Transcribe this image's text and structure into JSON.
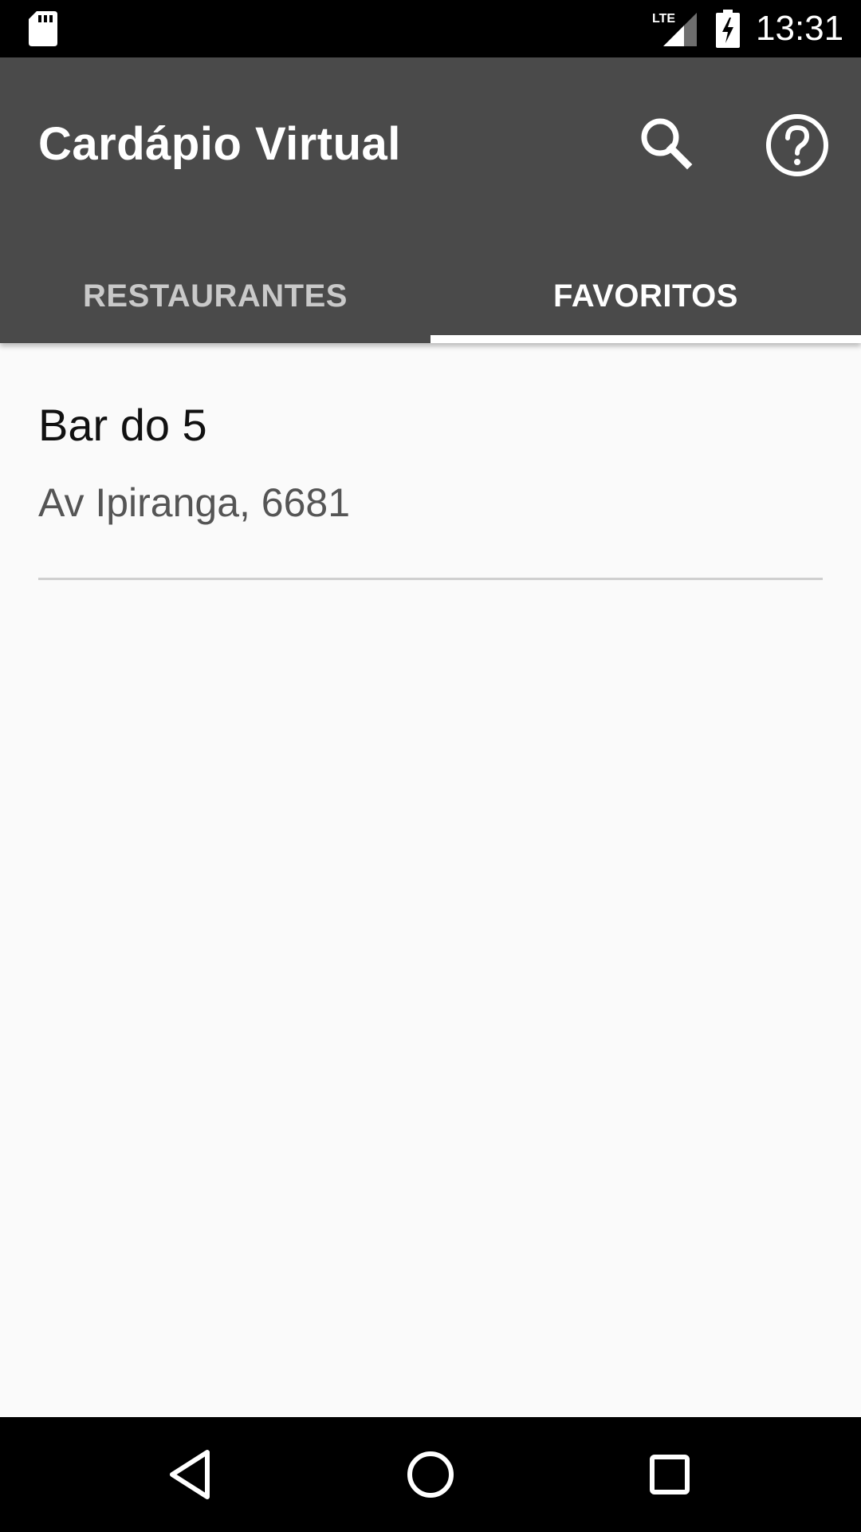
{
  "status_bar": {
    "time": "13:31",
    "network": "LTE",
    "icons": [
      "sd-card-icon",
      "lte-signal-icon",
      "battery-charging-icon"
    ]
  },
  "app_bar": {
    "title": "Cardápio Virtual",
    "actions": [
      "search-icon",
      "help-icon"
    ],
    "background_color": "#4a4a4a"
  },
  "tabs": [
    {
      "label": "RESTAURANTES",
      "selected": false
    },
    {
      "label": "FAVORITOS",
      "selected": true
    }
  ],
  "favorites": [
    {
      "name": "Bar do 5",
      "address": "Av Ipiranga, 6681"
    }
  ],
  "nav_bar": {
    "buttons": [
      "back-icon",
      "home-icon",
      "recents-icon"
    ]
  }
}
